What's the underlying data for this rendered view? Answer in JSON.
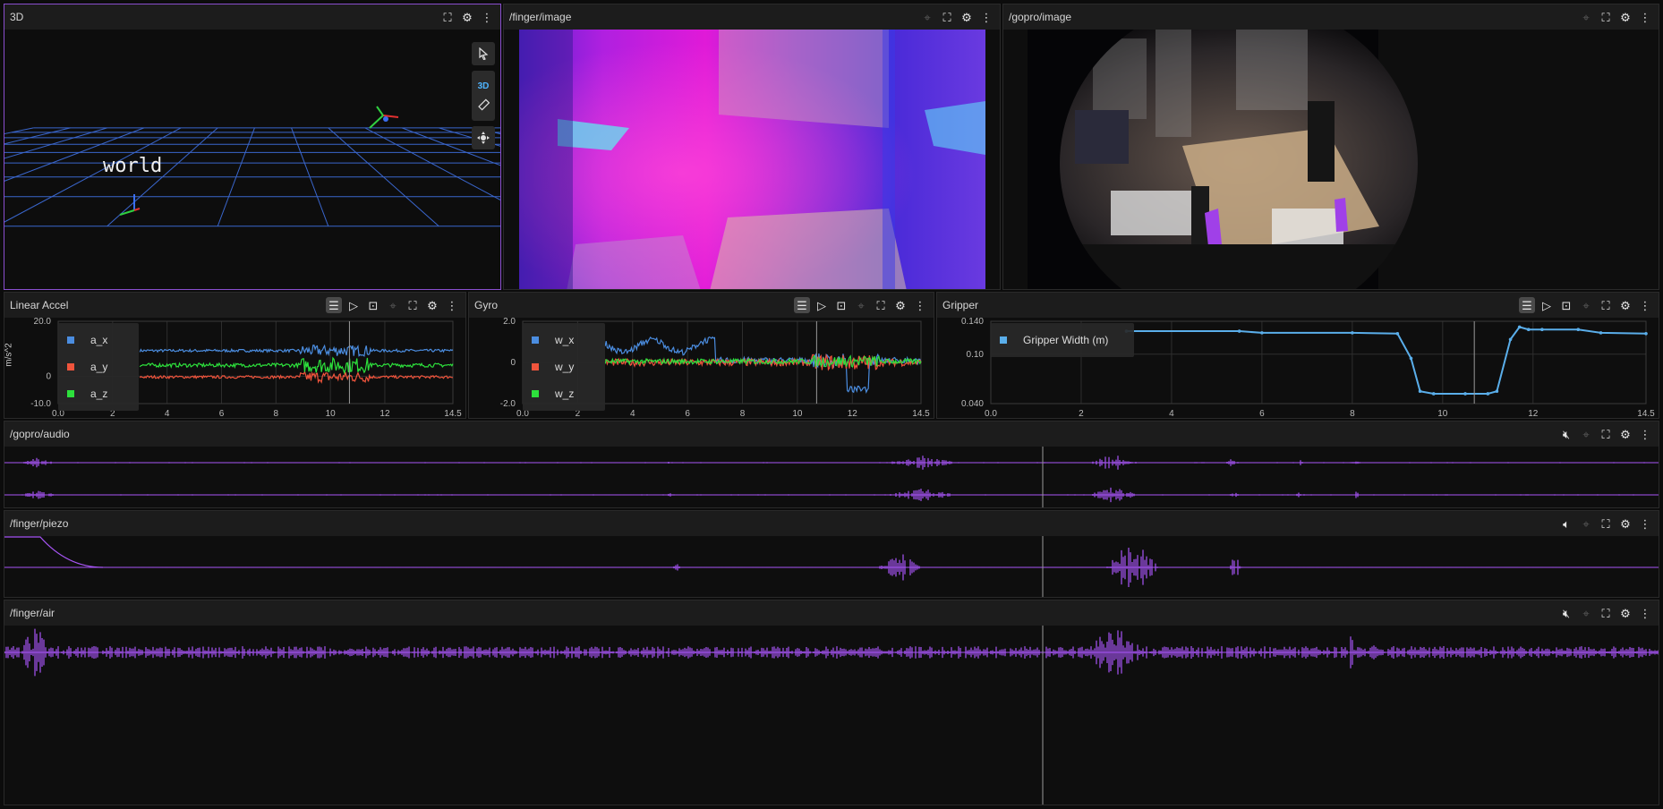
{
  "panels": {
    "view3d": {
      "title": "3D",
      "label_world": "world",
      "mode_label": "3D"
    },
    "finger_image": {
      "title": "/finger/image"
    },
    "gopro_image": {
      "title": "/gopro/image"
    },
    "linear_accel": {
      "title": "Linear Accel",
      "ylabel": "m/s^2"
    },
    "gyro": {
      "title": "Gyro"
    },
    "gripper": {
      "title": "Gripper"
    },
    "gopro_audio": {
      "title": "/gopro/audio"
    },
    "finger_piezo": {
      "title": "/finger/piezo"
    },
    "finger_air": {
      "title": "/finger/air"
    }
  },
  "chart_data": [
    {
      "type": "line",
      "title": "Linear Accel",
      "ylabel": "m/s^2",
      "xlim": [
        0,
        14.5
      ],
      "ylim": [
        -10,
        20
      ],
      "x_ticks": [
        "0.0",
        "2",
        "4",
        "6",
        "8",
        "10",
        "12",
        "14.5"
      ],
      "y_ticks": [
        "20.0",
        "0",
        "-10.0"
      ],
      "cursor_x": 10.7,
      "legend": "top-left",
      "series": [
        {
          "name": "a_x",
          "color": "#4b8de0",
          "base": 9.3,
          "noise": 1.0
        },
        {
          "name": "a_y",
          "color": "#f0543c",
          "base": -0.3,
          "noise": 1.0
        },
        {
          "name": "a_z",
          "color": "#2de03c",
          "base": 4.0,
          "noise": 1.4
        }
      ]
    },
    {
      "type": "line",
      "title": "Gyro",
      "xlim": [
        0,
        14.5
      ],
      "ylim": [
        -2,
        2
      ],
      "x_ticks": [
        "0.0",
        "2",
        "4",
        "6",
        "8",
        "10",
        "12",
        "14.5"
      ],
      "y_ticks": [
        "2.0",
        "0",
        "-2.0"
      ],
      "cursor_x": 10.7,
      "legend": "top-left",
      "series": [
        {
          "name": "w_x",
          "color": "#4b8de0",
          "base": 0.8,
          "noise": 0.3
        },
        {
          "name": "w_y",
          "color": "#f0543c",
          "base": 0.0,
          "noise": 0.35
        },
        {
          "name": "w_z",
          "color": "#2de03c",
          "base": 0.05,
          "noise": 0.25
        }
      ]
    },
    {
      "type": "line",
      "title": "Gripper",
      "xlim": [
        0,
        14.5
      ],
      "ylim": [
        0.04,
        0.14
      ],
      "x_ticks": [
        "0.0",
        "2",
        "4",
        "6",
        "8",
        "10",
        "12",
        "14.5"
      ],
      "y_ticks": [
        "0.140",
        "0.10",
        "0.040"
      ],
      "cursor_x": 10.7,
      "legend": "top-left",
      "series": [
        {
          "name": "Gripper Width (m)",
          "color": "#5aaeea",
          "x": [
            3.0,
            5.5,
            6.0,
            8.0,
            9.0,
            9.3,
            9.5,
            9.8,
            10.5,
            11.0,
            11.2,
            11.5,
            11.7,
            11.9,
            12.2,
            13.0,
            13.5,
            14.5
          ],
          "y": [
            0.128,
            0.128,
            0.126,
            0.126,
            0.125,
            0.095,
            0.055,
            0.052,
            0.052,
            0.052,
            0.055,
            0.118,
            0.133,
            0.13,
            0.13,
            0.13,
            0.126,
            0.125
          ]
        }
      ]
    }
  ],
  "colors": {
    "accent": "#8a4fcf",
    "waveform": "#a855f7",
    "grid": "#3a66cc"
  }
}
